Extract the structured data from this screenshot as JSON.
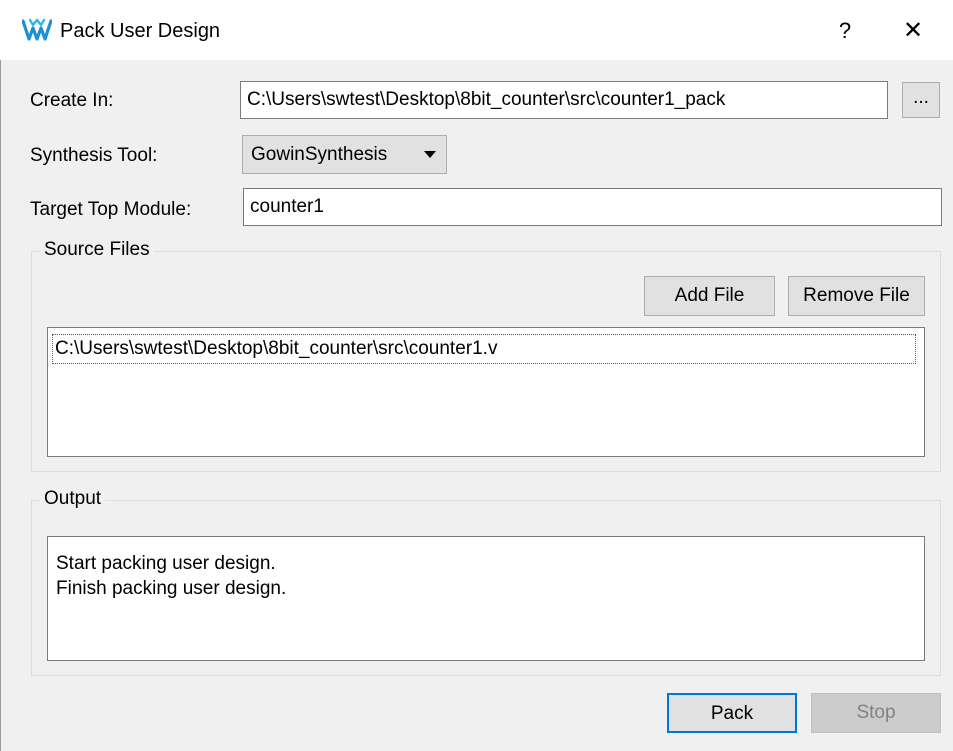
{
  "window": {
    "title": "Pack User Design",
    "help_label": "?",
    "close_label": "✕"
  },
  "form": {
    "create_in_label": "Create In:",
    "create_in_value": "C:\\Users\\swtest\\Desktop\\8bit_counter\\src\\counter1_pack",
    "browse_label": "...",
    "synthesis_tool_label": "Synthesis Tool:",
    "synthesis_tool_value": "GowinSynthesis",
    "target_top_label": "Target Top Module:",
    "target_top_value": "counter1"
  },
  "source_files": {
    "title": "Source Files",
    "add_label": "Add File",
    "remove_label": "Remove File",
    "files": [
      "C:\\Users\\swtest\\Desktop\\8bit_counter\\src\\counter1.v"
    ]
  },
  "output": {
    "title": "Output",
    "lines": [
      "Start packing user design.",
      "Finish packing user design."
    ]
  },
  "actions": {
    "pack_label": "Pack",
    "stop_label": "Stop"
  }
}
